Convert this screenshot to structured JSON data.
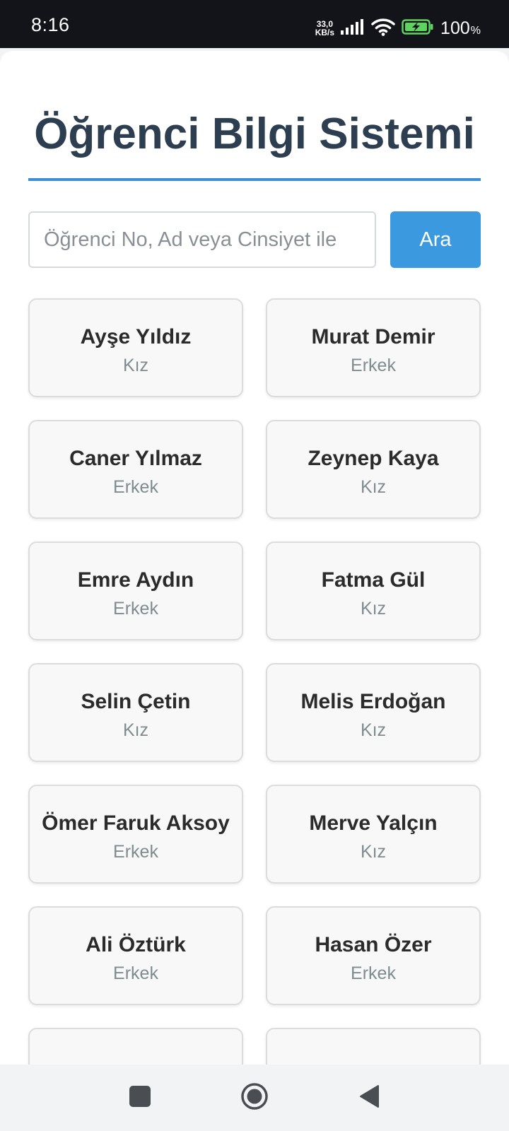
{
  "status_bar": {
    "time": "8:16",
    "net_speed_value": "33,0",
    "net_speed_unit": "KB/s",
    "battery_level": "100",
    "battery_unit": "%",
    "icons": [
      "signal-icon",
      "wifi-icon",
      "battery-charging-icon"
    ]
  },
  "page": {
    "title": "Öğrenci Bilgi Sistemi",
    "accent_color": "#3a8fd6"
  },
  "search": {
    "placeholder": "Öğrenci No, Ad veya Cinsiyet ile",
    "value": "",
    "button_label": "Ara"
  },
  "students": [
    {
      "name": "Ayşe Yıldız",
      "gender": "Kız"
    },
    {
      "name": "Murat Demir",
      "gender": "Erkek"
    },
    {
      "name": "Caner Yılmaz",
      "gender": "Erkek"
    },
    {
      "name": "Zeynep Kaya",
      "gender": "Kız"
    },
    {
      "name": "Emre Aydın",
      "gender": "Erkek"
    },
    {
      "name": "Fatma Gül",
      "gender": "Kız"
    },
    {
      "name": "Selin Çetin",
      "gender": "Kız"
    },
    {
      "name": "Melis Erdoğan",
      "gender": "Kız"
    },
    {
      "name": "Ömer Faruk Aksoy",
      "gender": "Erkek"
    },
    {
      "name": "Merve Yalçın",
      "gender": "Kız"
    },
    {
      "name": "Ali Öztürk",
      "gender": "Erkek"
    },
    {
      "name": "Hasan Özer",
      "gender": "Erkek"
    },
    {
      "name": "",
      "gender": ""
    },
    {
      "name": "",
      "gender": ""
    }
  ],
  "nav_bar": {
    "icons": [
      "recent-apps-icon",
      "home-icon",
      "back-icon"
    ]
  }
}
